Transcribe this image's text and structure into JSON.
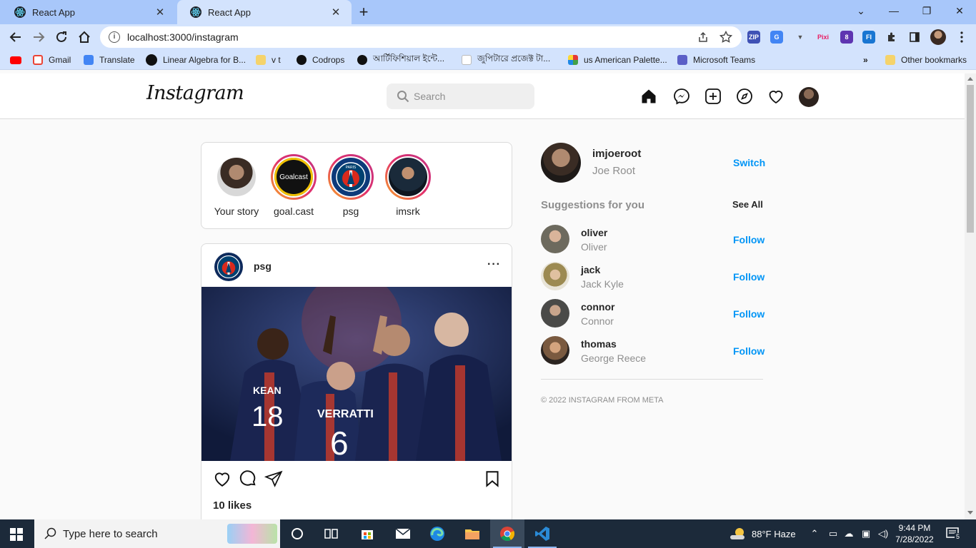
{
  "browser": {
    "tabs": [
      {
        "title": "React App",
        "active": false
      },
      {
        "title": "React App",
        "active": true
      }
    ],
    "url": "localhost:3000/instagram",
    "bookmarks": [
      {
        "label": "",
        "icon": "youtube-icon",
        "color": "#ff0000"
      },
      {
        "label": "Gmail",
        "icon": "gmail-icon",
        "color": "#ea4335"
      },
      {
        "label": "Translate",
        "icon": "translate-icon",
        "color": "#4285f4"
      },
      {
        "label": "Linear Algebra for B...",
        "icon": "sk-icon",
        "color": "#111111"
      },
      {
        "label": "v t",
        "icon": "folder-icon",
        "color": "#f5d36b"
      },
      {
        "label": "Codrops",
        "icon": "github-icon",
        "color": "#111111"
      },
      {
        "label": "আর্টিফিশিয়াল ইন্টে...",
        "icon": "medium-icon",
        "color": "#111111"
      },
      {
        "label": "জুপিটারে প্রজেক্ট টা...",
        "icon": "page-icon",
        "color": "#ffffff"
      },
      {
        "label": "us American Palette...",
        "icon": "palette-icon",
        "color": "#e53935"
      },
      {
        "label": "Microsoft Teams",
        "icon": "teams-icon",
        "color": "#5b5fc7"
      }
    ],
    "more_bookmarks": "»",
    "other_bookmarks": "Other bookmarks"
  },
  "instagram": {
    "logo": "Instagram",
    "search_placeholder": "Search",
    "stories": [
      {
        "name": "Your story"
      },
      {
        "name": "goal.cast",
        "badge": "Goalcast"
      },
      {
        "name": "psg",
        "badge": "PARIS"
      },
      {
        "name": "imsrk"
      }
    ],
    "post": {
      "username": "psg",
      "more": "···",
      "jersey_names": [
        "KEAN",
        "VERRATTI"
      ],
      "jersey_numbers": [
        "18",
        "6"
      ],
      "likes": "10 likes"
    },
    "me": {
      "username": "imjoeroot",
      "full_name": "Joe Root",
      "switch_label": "Switch"
    },
    "suggestions_title": "Suggestions for you",
    "see_all": "See All",
    "suggestions": [
      {
        "username": "oliver",
        "name": "Oliver",
        "follow": "Follow",
        "color": "#6d6a5e"
      },
      {
        "username": "jack",
        "name": "Jack Kyle",
        "follow": "Follow",
        "color": "#9c8a52"
      },
      {
        "username": "connor",
        "name": "Connor",
        "follow": "Follow",
        "color": "#4a4a48"
      },
      {
        "username": "thomas",
        "name": "George Reece",
        "follow": "Follow",
        "color": "#7a5a40"
      }
    ],
    "footer": "© 2022 INSTAGRAM FROM META"
  },
  "taskbar": {
    "search_placeholder": "Type here to search",
    "weather": "88°F  Haze",
    "time": "9:44 PM",
    "date": "7/28/2022",
    "notifications": "5"
  }
}
